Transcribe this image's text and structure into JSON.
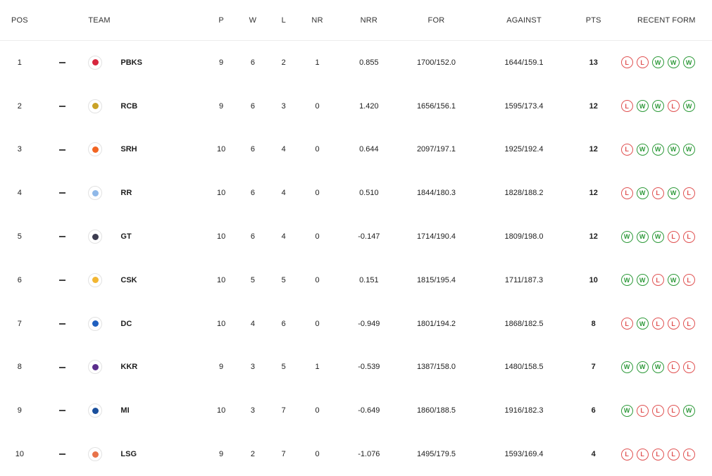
{
  "headers": {
    "pos": "POS",
    "team": "TEAM",
    "p": "P",
    "w": "W",
    "l": "L",
    "nr": "NR",
    "nrr": "NRR",
    "for": "FOR",
    "against": "AGAINST",
    "pts": "PTS",
    "form": "RECENT FORM"
  },
  "rows": [
    {
      "pos": "1",
      "team": "PBKS",
      "color": "#d7263d",
      "p": "9",
      "w": "6",
      "l": "2",
      "nr": "1",
      "nrr": "0.855",
      "for": "1700/152.0",
      "against": "1644/159.1",
      "pts": "13",
      "form": [
        "L",
        "L",
        "W",
        "W",
        "W"
      ]
    },
    {
      "pos": "2",
      "team": "RCB",
      "color": "#c9a227",
      "p": "9",
      "w": "6",
      "l": "3",
      "nr": "0",
      "nrr": "1.420",
      "for": "1656/156.1",
      "against": "1595/173.4",
      "pts": "12",
      "form": [
        "L",
        "W",
        "W",
        "L",
        "W"
      ]
    },
    {
      "pos": "3",
      "team": "SRH",
      "color": "#f26522",
      "p": "10",
      "w": "6",
      "l": "4",
      "nr": "0",
      "nrr": "0.644",
      "for": "2097/197.1",
      "against": "1925/192.4",
      "pts": "12",
      "form": [
        "L",
        "W",
        "W",
        "W",
        "W"
      ]
    },
    {
      "pos": "4",
      "team": "RR",
      "color": "#8fb8e8",
      "p": "10",
      "w": "6",
      "l": "4",
      "nr": "0",
      "nrr": "0.510",
      "for": "1844/180.3",
      "against": "1828/188.2",
      "pts": "12",
      "form": [
        "L",
        "W",
        "L",
        "W",
        "L"
      ]
    },
    {
      "pos": "5",
      "team": "GT",
      "color": "#3b3b4f",
      "p": "10",
      "w": "6",
      "l": "4",
      "nr": "0",
      "nrr": "-0.147",
      "for": "1714/190.4",
      "against": "1809/198.0",
      "pts": "12",
      "form": [
        "W",
        "W",
        "W",
        "L",
        "L"
      ]
    },
    {
      "pos": "6",
      "team": "CSK",
      "color": "#f2b632",
      "p": "10",
      "w": "5",
      "l": "5",
      "nr": "0",
      "nrr": "0.151",
      "for": "1815/195.4",
      "against": "1711/187.3",
      "pts": "10",
      "form": [
        "W",
        "W",
        "L",
        "W",
        "L"
      ]
    },
    {
      "pos": "7",
      "team": "DC",
      "color": "#1f5fbf",
      "p": "10",
      "w": "4",
      "l": "6",
      "nr": "0",
      "nrr": "-0.949",
      "for": "1801/194.2",
      "against": "1868/182.5",
      "pts": "8",
      "form": [
        "L",
        "W",
        "L",
        "L",
        "L"
      ]
    },
    {
      "pos": "8",
      "team": "KKR",
      "color": "#5a2d8c",
      "p": "9",
      "w": "3",
      "l": "5",
      "nr": "1",
      "nrr": "-0.539",
      "for": "1387/158.0",
      "against": "1480/158.5",
      "pts": "7",
      "form": [
        "W",
        "W",
        "W",
        "L",
        "L"
      ]
    },
    {
      "pos": "9",
      "team": "MI",
      "color": "#1a4f9c",
      "p": "10",
      "w": "3",
      "l": "7",
      "nr": "0",
      "nrr": "-0.649",
      "for": "1860/188.5",
      "against": "1916/182.3",
      "pts": "6",
      "form": [
        "W",
        "L",
        "L",
        "L",
        "W"
      ]
    },
    {
      "pos": "10",
      "team": "LSG",
      "color": "#e8734a",
      "p": "9",
      "w": "2",
      "l": "7",
      "nr": "0",
      "nrr": "-1.076",
      "for": "1495/179.5",
      "against": "1593/169.4",
      "pts": "4",
      "form": [
        "L",
        "L",
        "L",
        "L",
        "L"
      ]
    }
  ],
  "colors": {
    "win": "#2e9a3a",
    "loss": "#e05252"
  }
}
